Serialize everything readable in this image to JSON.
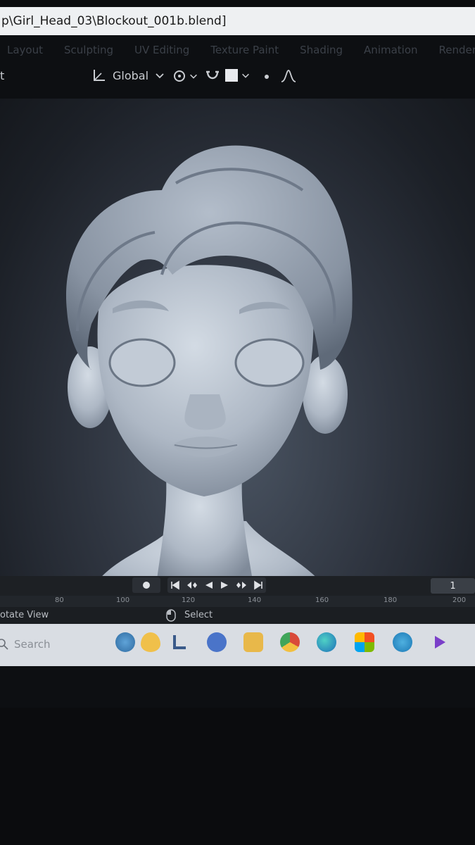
{
  "window": {
    "title": "p\\Girl_Head_03\\Blockout_001b.blend]"
  },
  "workspace_tabs": [
    "Layout",
    "Sculpting",
    "UV Editing",
    "Texture Paint",
    "Shading",
    "Animation",
    "Rendering"
  ],
  "header": {
    "mode_fragment": "t",
    "transform_orientation": "Global"
  },
  "timeline": {
    "current_frame": "1",
    "ruler_ticks": [
      "80",
      "100",
      "120",
      "140",
      "160",
      "180",
      "200"
    ]
  },
  "status_bar": {
    "left_hint": "otate View",
    "center_hint": "Select"
  },
  "taskbar": {
    "search_placeholder": "Search"
  },
  "colors": {
    "title_bar_bg": "#eef0f2",
    "viewport_bg": "#2f3540",
    "model_clay": "#b9c3cf",
    "taskbar_bg": "#d9dde3"
  },
  "icons": [
    "transform-orientation-icon",
    "chevron-down-icon",
    "snap-icon",
    "proportional-edit-icon",
    "record-icon",
    "jump-start-icon",
    "prev-keyframe-icon",
    "play-reverse-icon",
    "play-icon",
    "next-keyframe-icon",
    "jump-end-icon",
    "mouse-icon",
    "search-icon",
    "weather-icon",
    "file-explorer-icon",
    "chrome-icon",
    "edge-icon",
    "store-icon"
  ]
}
